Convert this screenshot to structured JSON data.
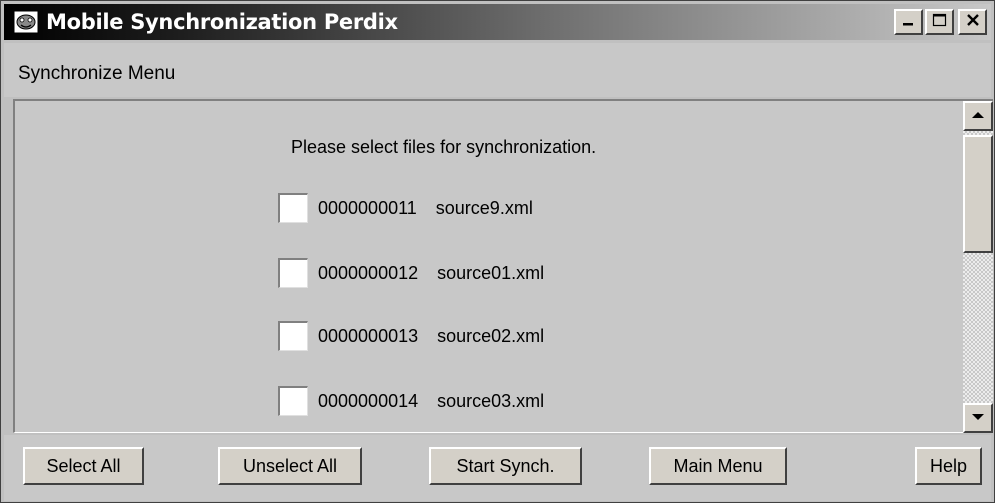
{
  "window": {
    "title": "Mobile Synchronization Perdix",
    "minimize_label": "_",
    "maximize_label": "□",
    "close_label": "X"
  },
  "menu": {
    "label": "Synchronize Menu"
  },
  "content": {
    "instruction": "Please select files for synchronization.",
    "files": [
      {
        "id": "0000000011",
        "name": "source9.xml",
        "checked": false
      },
      {
        "id": "0000000012",
        "name": "source01.xml",
        "checked": false
      },
      {
        "id": "0000000013",
        "name": "source02.xml",
        "checked": false
      },
      {
        "id": "0000000014",
        "name": "source03.xml",
        "checked": false
      }
    ]
  },
  "buttons": {
    "select_all": "Select All",
    "unselect_all": "Unselect All",
    "start_synch": "Start Synch.",
    "main_menu": "Main Menu",
    "help": "Help"
  },
  "icons": {
    "app": "perdix-app-icon",
    "minimize": "minimize-icon",
    "maximize": "maximize-icon",
    "close": "close-icon",
    "scroll_up": "arrow-up-icon",
    "scroll_down": "arrow-down-icon"
  },
  "colors": {
    "title_gradient_start": "#000000",
    "title_gradient_end": "#c8c8c8",
    "face": "#c8c8c8",
    "checkbox_fill": "#ffffff"
  }
}
